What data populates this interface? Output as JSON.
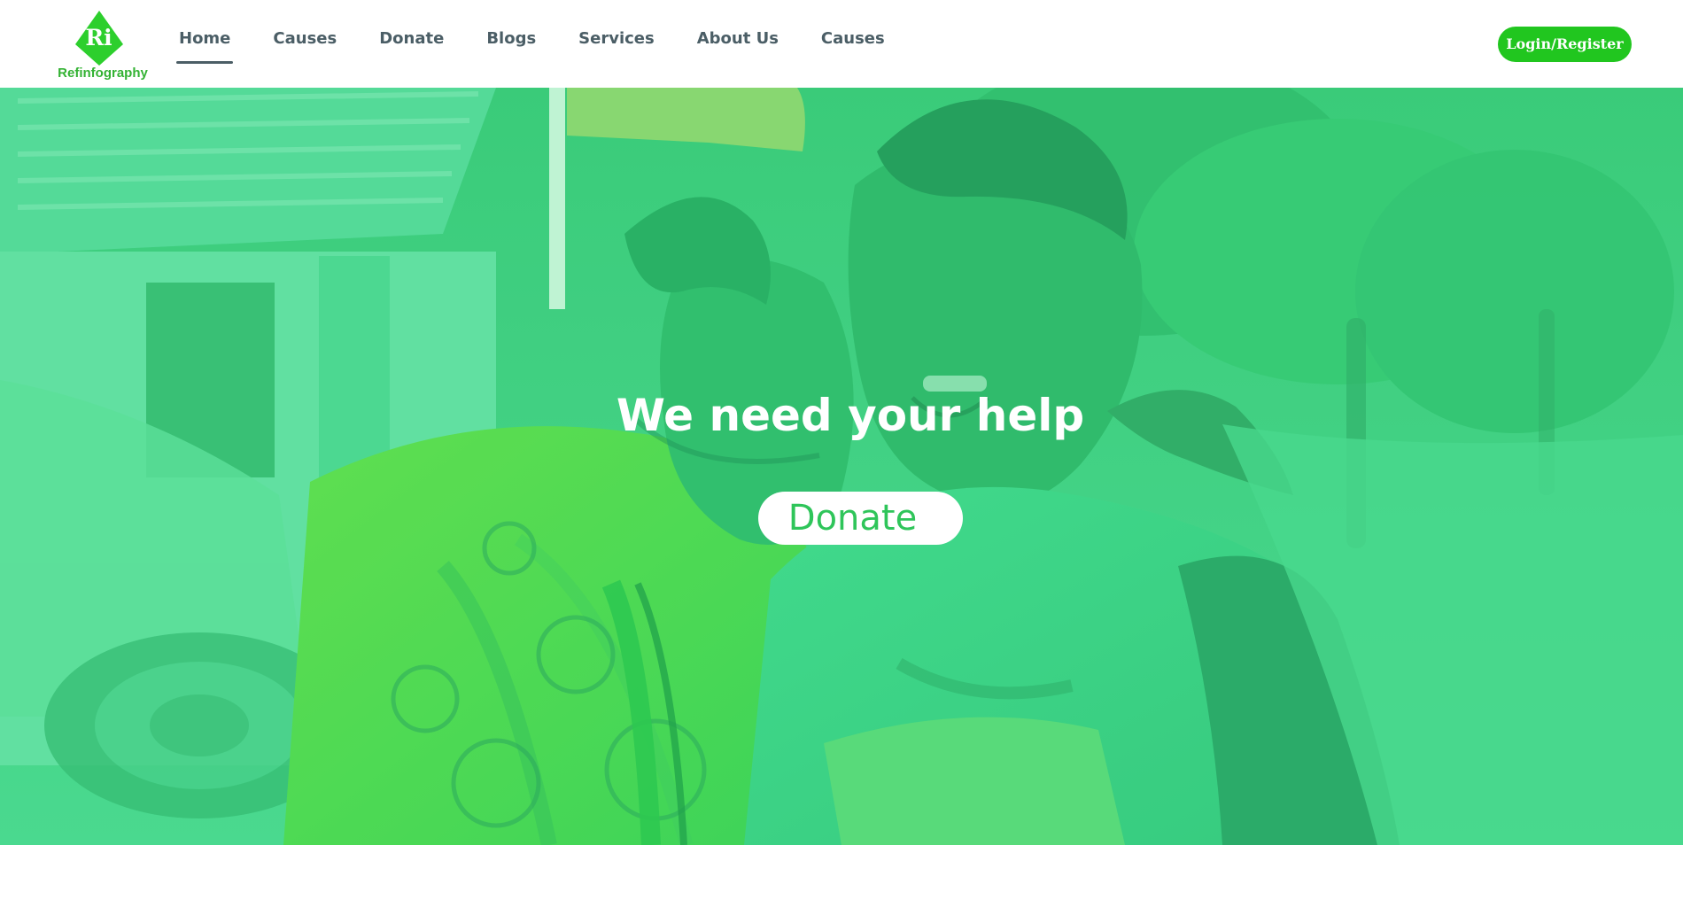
{
  "brand": {
    "name": "Refinfography",
    "mark": "Ri",
    "color": "#33b233"
  },
  "nav": {
    "items": [
      {
        "label": "Home",
        "active": true
      },
      {
        "label": "Causes",
        "active": false
      },
      {
        "label": "Donate",
        "active": false
      },
      {
        "label": "Blogs",
        "active": false
      },
      {
        "label": "Services",
        "active": false
      },
      {
        "label": "About Us",
        "active": false
      },
      {
        "label": "Causes",
        "active": false
      }
    ],
    "text_color": "#4b5e66"
  },
  "account": {
    "login_label": "Login/Register",
    "button_color": "#21c61f"
  },
  "hero": {
    "title": "We need your help",
    "donate_label": "Donate",
    "tint_color": "#3ccf7c"
  }
}
